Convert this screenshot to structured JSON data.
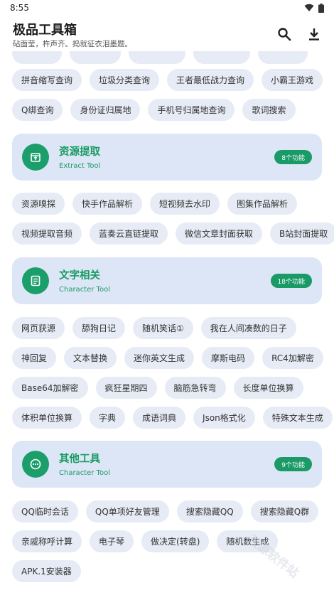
{
  "status_bar": {
    "time": "8:55"
  },
  "app_bar": {
    "title": "极品工具箱",
    "subtitle": "砧面莹，杵声齐。捣就征衣泪墨题。"
  },
  "partial_row": [
    "",
    "",
    "",
    "",
    ""
  ],
  "top_rows": [
    [
      "拼音缩写查询",
      "垃圾分类查询",
      "王者最低战力查询",
      "小霸王游戏"
    ],
    [
      "Q绑查询",
      "身份证归属地",
      "手机号归属地查询",
      "歌词搜索"
    ]
  ],
  "categories": [
    {
      "name": "资源提取",
      "subtitle": "Extract Tool",
      "badge": "8个功能",
      "rows": [
        [
          "资源嗅探",
          "快手作品解析",
          "短视频去水印",
          "图集作品解析"
        ],
        [
          "视频提取音频",
          "蓝奏云直链提取",
          "微信文章封面获取",
          "B站封面提取"
        ]
      ]
    },
    {
      "name": "文字相关",
      "subtitle": "Character Tool",
      "badge": "18个功能",
      "rows": [
        [
          "网页获源",
          "舔狗日记",
          "随机笑话①",
          "我在人间凑数的日子"
        ],
        [
          "神回复",
          "文本替换",
          "迷你英文生成",
          "摩斯电码",
          "RC4加解密"
        ],
        [
          "Base64加解密",
          "疯狂星期四",
          "脑筋急转弯",
          "长度单位换算"
        ],
        [
          "体积单位换算",
          "字典",
          "成语词典",
          "Json格式化",
          "特殊文本生成"
        ]
      ]
    },
    {
      "name": "其他工具",
      "subtitle": "Character Tool",
      "badge": "9个功能",
      "rows": [
        [
          "QQ临时会话",
          "QQ单项好友管理",
          "搜索隐藏QQ",
          "搜索隐藏Q群"
        ],
        [
          "亲戚称呼计算",
          "电子琴",
          "做决定(转盘)",
          "随机数生成"
        ],
        [
          "APK.1安装器"
        ]
      ]
    }
  ],
  "watermark": "天源软件站",
  "colors": {
    "accent": "#1c9e6b",
    "card_bg": "#dde6f6",
    "chip_bg": "#e6ebf5"
  }
}
